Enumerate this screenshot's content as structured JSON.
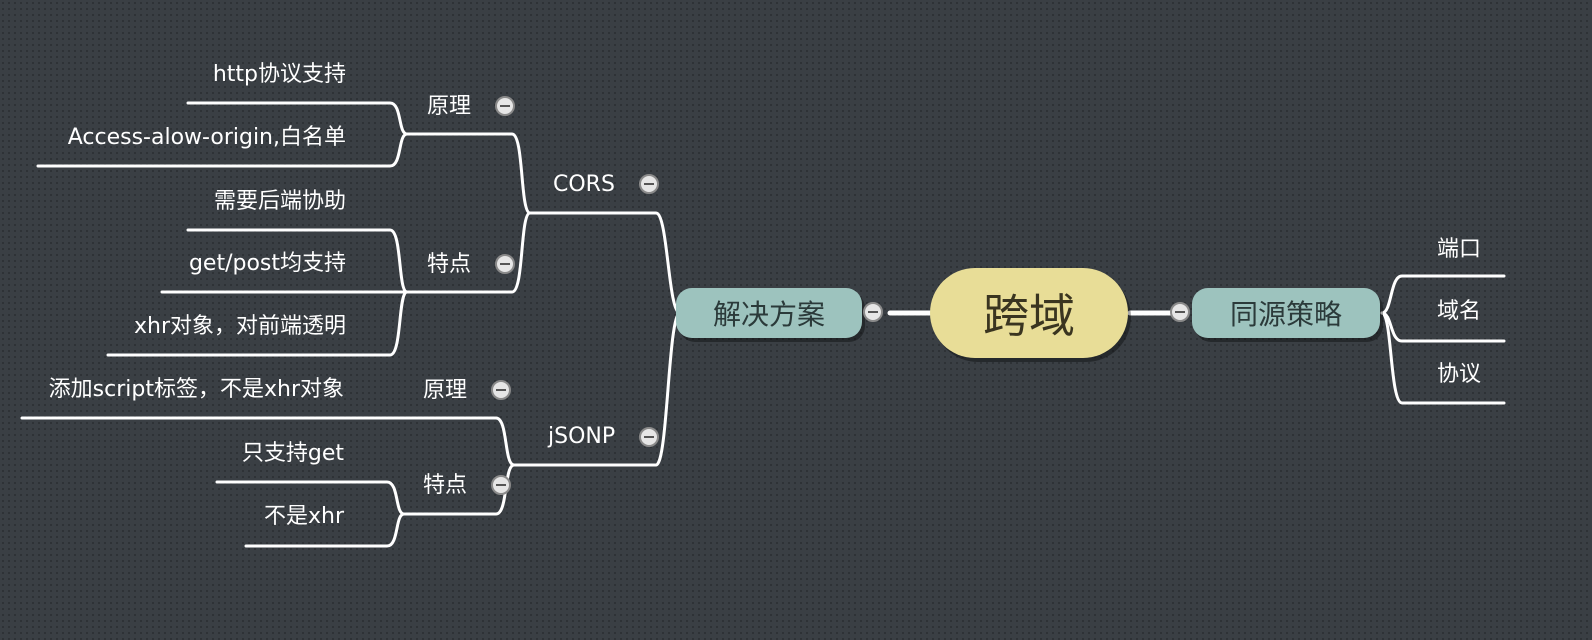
{
  "central": "跨域",
  "left_topic": {
    "label": "解决方案",
    "children": [
      {
        "label": "CORS",
        "children": [
          {
            "label": "原理",
            "items": [
              "http协议支持",
              "Access-alow-origin,白名单"
            ]
          },
          {
            "label": "特点",
            "items": [
              "需要后端协助",
              "get/post均支持",
              "xhr对象，对前端透明"
            ]
          }
        ]
      },
      {
        "label": "jSONP",
        "children": [
          {
            "label": "原理",
            "items": [
              "添加script标签，不是xhr对象"
            ]
          },
          {
            "label": "特点",
            "items": [
              "只支持get",
              "不是xhr"
            ]
          }
        ]
      }
    ]
  },
  "right_topic": {
    "label": "同源策略",
    "items": [
      "端口",
      "域名",
      "协议"
    ]
  },
  "colors": {
    "background": "#3a3f44",
    "central_fill": "#e8dd97",
    "topic_fill": "#9dc3be",
    "line": "#ffffff"
  }
}
